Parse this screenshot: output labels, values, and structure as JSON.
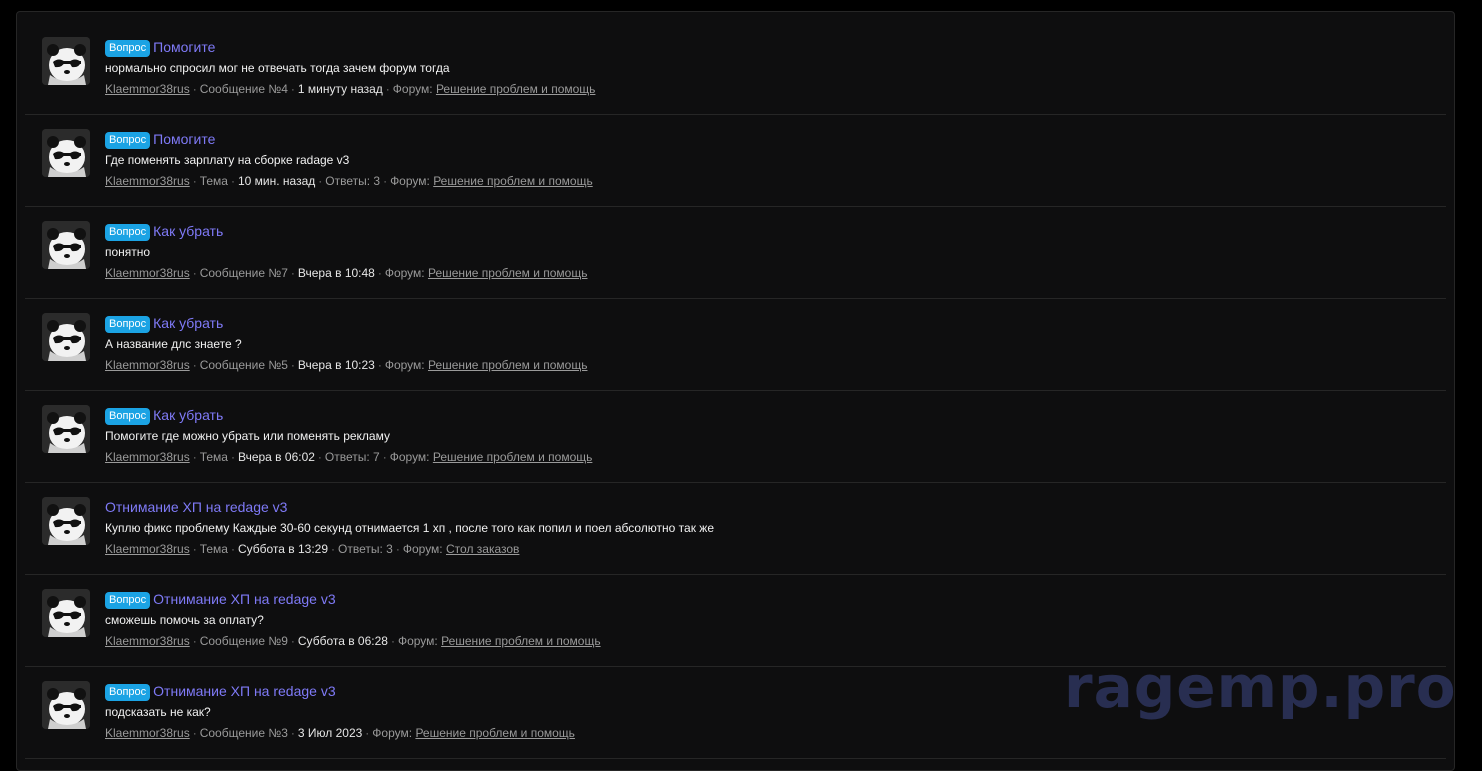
{
  "colors": {
    "background": "#0e0e0f",
    "title_link": "#7f7af7",
    "badge": "#1ba3e4",
    "meta_text": "#9a9a9a",
    "watermark": "#2a3055"
  },
  "labels": {
    "forum_prefix": "Форум:"
  },
  "watermark": "ragemp.pro",
  "items": [
    {
      "badge": "Вопрос",
      "title": "Помогите",
      "snippet": "нормально спросил мог не отвечать тогда зачем форум тогда",
      "author": "Klaemmor38rus",
      "kind": "Сообщение №4",
      "time": "1 минуту назад",
      "replies": "",
      "forum": "Решение проблем и помощь",
      "avatar_icon": "panda-avatar-icon"
    },
    {
      "badge": "Вопрос",
      "title": "Помогите",
      "snippet": "Где поменять зарплату на сборке radage v3",
      "author": "Klaemmor38rus",
      "kind": "Тема",
      "time": "10 мин. назад",
      "replies": "Ответы: 3",
      "forum": "Решение проблем и помощь",
      "avatar_icon": "panda-avatar-icon"
    },
    {
      "badge": "Вопрос",
      "title": "Как убрать",
      "snippet": "понятно",
      "author": "Klaemmor38rus",
      "kind": "Сообщение №7",
      "time": "Вчера в 10:48",
      "replies": "",
      "forum": "Решение проблем и помощь",
      "avatar_icon": "panda-avatar-icon"
    },
    {
      "badge": "Вопрос",
      "title": "Как убрать",
      "snippet": "А название длс знаете ?",
      "author": "Klaemmor38rus",
      "kind": "Сообщение №5",
      "time": "Вчера в 10:23",
      "replies": "",
      "forum": "Решение проблем и помощь",
      "avatar_icon": "panda-avatar-icon"
    },
    {
      "badge": "Вопрос",
      "title": "Как убрать",
      "snippet": "Помогите где можно убрать или поменять рекламу",
      "author": "Klaemmor38rus",
      "kind": "Тема",
      "time": "Вчера в 06:02",
      "replies": "Ответы: 7",
      "forum": "Решение проблем и помощь",
      "avatar_icon": "panda-avatar-icon"
    },
    {
      "badge": "",
      "title": "Отнимание ХП на redage v3",
      "snippet": "Куплю фикс проблему Каждые 30-60 секунд отнимается 1 хп , после того как попил и поел абсолютно так же",
      "author": "Klaemmor38rus",
      "kind": "Тема",
      "time": "Суббота в 13:29",
      "replies": "Ответы: 3",
      "forum": "Стол заказов",
      "avatar_icon": "panda-avatar-icon"
    },
    {
      "badge": "Вопрос",
      "title": "Отнимание ХП на redage v3",
      "snippet": "сможешь помочь за оплату?",
      "author": "Klaemmor38rus",
      "kind": "Сообщение №9",
      "time": "Суббота в 06:28",
      "replies": "",
      "forum": "Решение проблем и помощь",
      "avatar_icon": "panda-avatar-icon"
    },
    {
      "badge": "Вопрос",
      "title": "Отнимание ХП на redage v3",
      "snippet": "подсказать не как?",
      "author": "Klaemmor38rus",
      "kind": "Сообщение №3",
      "time": "3 Июл 2023",
      "replies": "",
      "forum": "Решение проблем и помощь",
      "avatar_icon": "panda-avatar-icon"
    }
  ]
}
